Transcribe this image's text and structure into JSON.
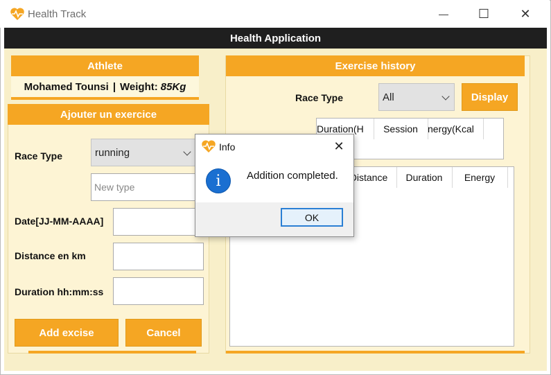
{
  "window": {
    "title": "Health Track",
    "minimize_glyph": "—",
    "maximize_glyph": "☐",
    "close_glyph": "✕",
    "app_icon": "heart-pulse-icon"
  },
  "header": {
    "title": "Health Application"
  },
  "athlete": {
    "header": "Athlete",
    "name": "Mohamed Tounsi",
    "separator": "|",
    "weight_label": "Weight:",
    "weight_value": "85Kg"
  },
  "add_exercise": {
    "header": "Ajouter un exercice",
    "race_type_label": "Race Type",
    "race_type_value": "running",
    "new_type_placeholder": "New type",
    "date_label": "Date[JJ-MM-AAAA]",
    "date_value": "",
    "distance_label": "Distance en km",
    "distance_value": "",
    "duration_label": "Duration hh:mm:ss",
    "duration_value": "",
    "add_button": "Add excise",
    "cancel_button": "Cancel"
  },
  "history": {
    "header": "Exercise history",
    "race_type_label": "Race Type",
    "race_type_value": "All",
    "display_button": "Display",
    "summary_columns": [
      "Duration(H",
      "Session",
      "nergy(Kcal"
    ],
    "detail_columns": [
      "",
      "Distance",
      "Duration",
      "Energy"
    ]
  },
  "dialog": {
    "title": "Info",
    "message": "Addition completed.",
    "ok_button": "OK",
    "close_glyph": "✕",
    "icon_glyph": "i"
  },
  "colors": {
    "accent": "#f5a623",
    "header_bg": "#1f1f1f",
    "panel_bg": "#f8efc9"
  }
}
